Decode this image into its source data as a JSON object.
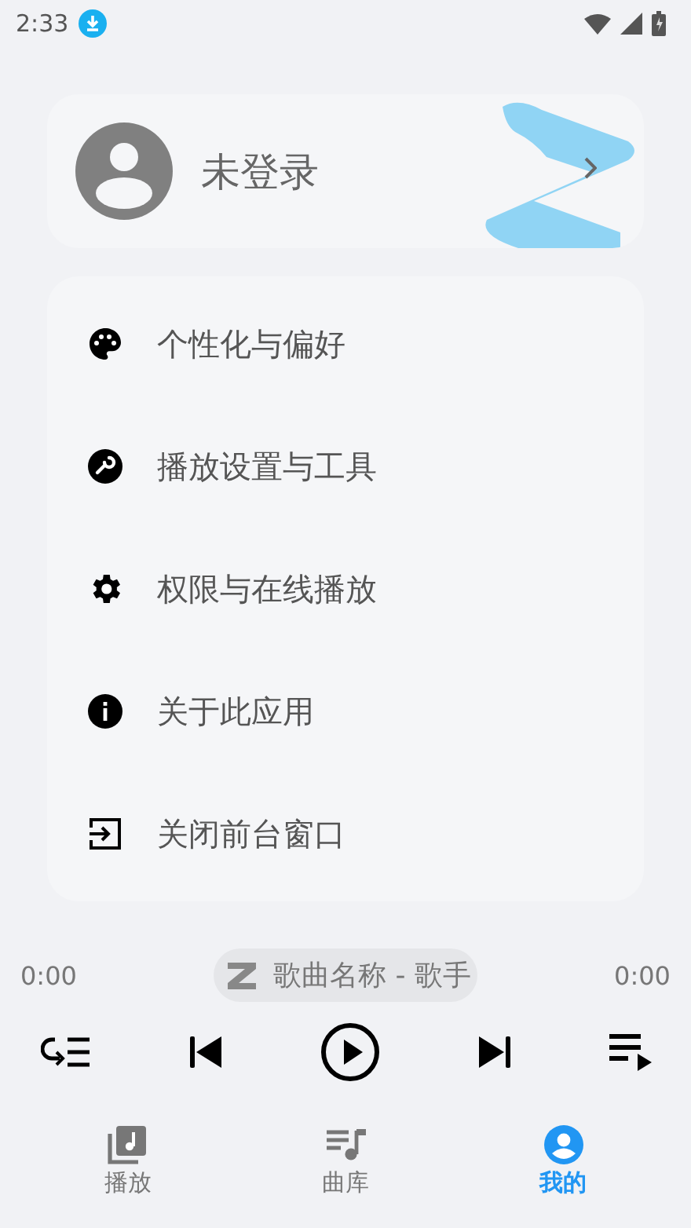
{
  "status_bar": {
    "time": "2:33"
  },
  "profile": {
    "name": "未登录"
  },
  "menu": [
    {
      "kind": "palette",
      "label": "个性化与偏好"
    },
    {
      "kind": "wrench",
      "label": "播放设置与工具"
    },
    {
      "kind": "gear",
      "label": "权限与在线播放"
    },
    {
      "kind": "info",
      "label": "关于此应用"
    },
    {
      "kind": "exit",
      "label": "关闭前台窗口"
    }
  ],
  "player": {
    "elapsed": "0:00",
    "track": "歌曲名称 - 歌手",
    "duration": "0:00",
    "playing": false
  },
  "nav": [
    {
      "kind": "player",
      "label": "播放",
      "selected": false
    },
    {
      "kind": "library",
      "label": "曲库",
      "selected": false
    },
    {
      "kind": "me",
      "label": "我的",
      "selected": true
    }
  ]
}
